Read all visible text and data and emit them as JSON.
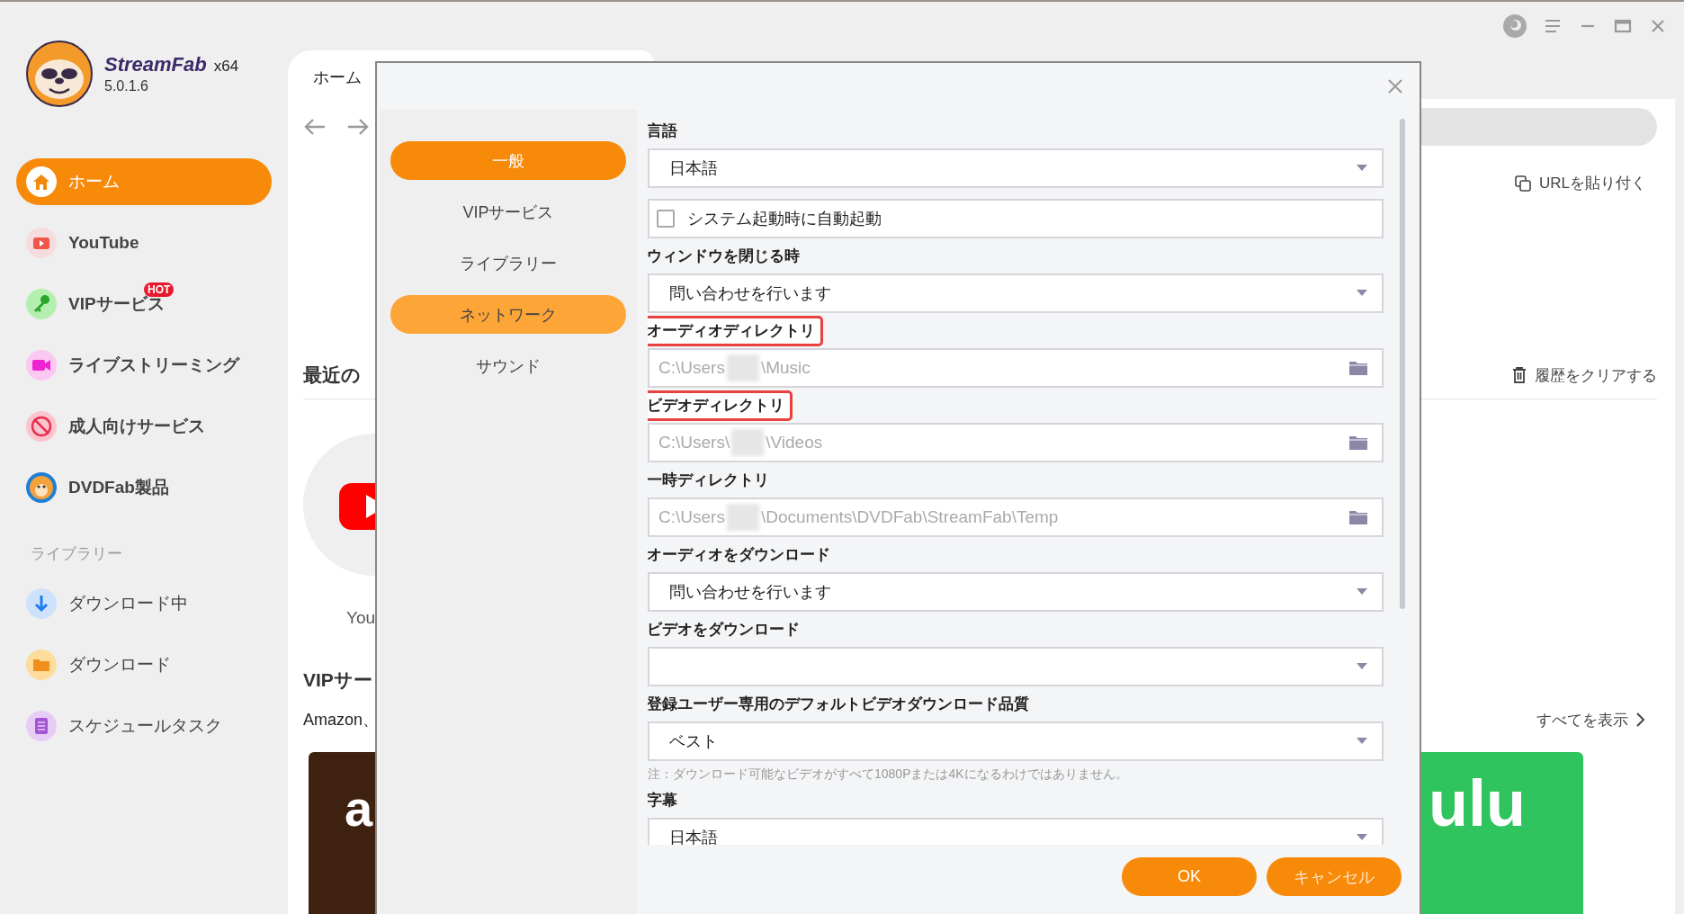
{
  "app": {
    "brand": "StreamFab",
    "arch": "x64",
    "version": "5.0.1.6"
  },
  "sidebar": {
    "items": [
      {
        "label": "ホーム",
        "selected": true
      },
      {
        "label": "YouTube",
        "selected": false
      },
      {
        "label": "VIPサービス",
        "selected": false,
        "badge": "HOT"
      },
      {
        "label": "ライブストリーミング",
        "selected": false
      },
      {
        "label": "成人向けサービス",
        "selected": false
      },
      {
        "label": "DVDFab製品",
        "selected": false
      }
    ],
    "library_heading": "ライブラリー",
    "library_items": [
      {
        "label": "ダウンロード中",
        "selected": false
      },
      {
        "label": "ダウンロード",
        "selected": false
      },
      {
        "label": "スケジュールタスク",
        "selected": false
      }
    ]
  },
  "main": {
    "tab": "ホーム",
    "paste_url": "URLを貼り付く",
    "recent_heading": "最近の",
    "clear_history": "履歴をクリアする",
    "recent_items": [
      {
        "label": "You"
      }
    ],
    "vip_heading": "VIPサー",
    "vip_description": "Amazon、",
    "show_all": "すべてを表示",
    "service_tiles": [
      {
        "text": "a",
        "color": "#3f2110"
      },
      {
        "text": "ulu",
        "color": "#2fc45e"
      }
    ]
  },
  "dialog": {
    "nav": [
      {
        "label": "一般",
        "selected": true,
        "hovered": false
      },
      {
        "label": "VIPサービス",
        "selected": false,
        "hovered": false
      },
      {
        "label": "ライブラリー",
        "selected": false,
        "hovered": false
      },
      {
        "label": "ネットワーク",
        "selected": false,
        "hovered": true
      },
      {
        "label": "サウンド",
        "selected": false,
        "hovered": false
      }
    ],
    "fields": [
      {
        "kind": "select",
        "label": "言語",
        "value": "日本語",
        "highlighted": false
      },
      {
        "kind": "checkbox",
        "value": "システム起動時に自動起動",
        "checked": false
      },
      {
        "kind": "select",
        "label": "ウィンドウを閉じる時",
        "value": "問い合わせを行います",
        "highlighted": false
      },
      {
        "kind": "path",
        "label": "オーディオディレクトリ",
        "value": "C:\\Users",
        "value_end": "\\Music",
        "redacted": true,
        "highlighted": true
      },
      {
        "kind": "path",
        "label": "ビデオディレクトリ",
        "value": "C:\\Users\\",
        "value_end": "\\Videos",
        "redacted": true,
        "highlighted": true
      },
      {
        "kind": "path",
        "label": "一時ディレクトリ",
        "value": "C:\\Users",
        "value_end": "\\Documents\\DVDFab\\StreamFab\\Temp",
        "redacted": true,
        "highlighted": false
      },
      {
        "kind": "select",
        "label": "オーディオをダウンロード",
        "value": "問い合わせを行います",
        "highlighted": false
      },
      {
        "kind": "select",
        "label": "ビデオをダウンロード",
        "highlighted": false
      },
      {
        "kind": "select",
        "label": "登録ユーザー専用のデフォルトビデオダウンロード品質",
        "value": "ベスト",
        "note": "注：ダウンロード可能なビデオがすべて1080Pまたは4Kになるわけではありません。",
        "highlighted": false
      },
      {
        "kind": "select",
        "label": "字幕",
        "value": "日本語",
        "highlighted": false
      }
    ],
    "buttons": [
      {
        "label": "OK"
      },
      {
        "label": "キャンセル"
      }
    ]
  }
}
